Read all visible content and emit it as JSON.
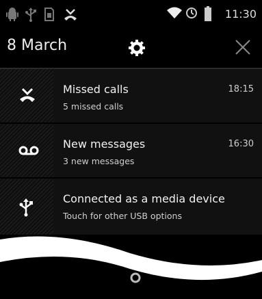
{
  "status_bar": {
    "time": "11:30",
    "icons_left": [
      "android-debug-icon",
      "usb-icon",
      "sim-card-icon",
      "missed-call-icon"
    ],
    "icons_right": [
      "wifi-icon",
      "alarm-icon",
      "battery-icon"
    ]
  },
  "header": {
    "date": "8 March"
  },
  "notifications": [
    {
      "title": "Missed calls",
      "subtitle": "5 missed calls",
      "time": "18:15",
      "icon": "missed-call-icon"
    },
    {
      "title": "New messages",
      "subtitle": "3 new messages",
      "time": "16:30",
      "icon": "voicemail-icon"
    },
    {
      "title": "Connected as a media device",
      "subtitle": "Touch for other USB options",
      "time": "",
      "icon": "usb-icon"
    }
  ],
  "colors": {
    "background": "#000000",
    "notification_bg": "#111111",
    "text_primary": "#f2f2f2",
    "text_secondary": "#d0d0d0"
  }
}
